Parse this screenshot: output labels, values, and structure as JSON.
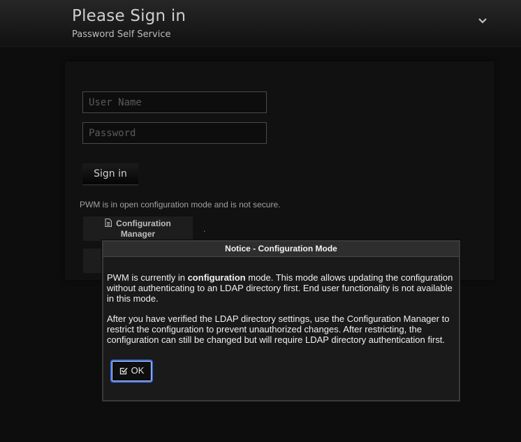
{
  "header": {
    "title": "Please Sign in",
    "subtitle": "Password Self Service",
    "menu_icon": "chevron-down-icon"
  },
  "login": {
    "username_placeholder": "User Name",
    "password_placeholder": "Password",
    "signin_label": "Sign in"
  },
  "config_notice": {
    "text": "PWM is in open configuration mode and is not secure.",
    "config_button_label_1": "Configuration",
    "config_button_label_2": "Manager",
    "dot": ".",
    "icon": "document-icon"
  },
  "dialog": {
    "title": "Notice - Configuration Mode",
    "para1_pre": "PWM is currently in ",
    "para1_bold": "configuration",
    "para1_post": " mode. This mode allows updating the configuration without authenticating to an LDAP directory first. End user functionality is not available in this mode.",
    "para2": "After you have verified the LDAP directory settings, use the Configuration Manager to restrict the configuration to prevent unauthorized changes. After restricting, the configuration can still be changed but will require LDAP directory authentication first.",
    "ok_label": "OK",
    "ok_icon": "check-square-icon",
    "accent_color": "#3d6de0"
  }
}
